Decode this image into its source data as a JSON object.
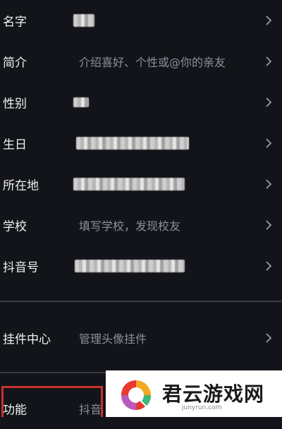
{
  "profile_rows": [
    {
      "label": "名字",
      "value": ""
    },
    {
      "label": "简介",
      "value": "介绍喜好、个性或@你的亲友"
    },
    {
      "label": "性别",
      "value": ""
    },
    {
      "label": "生日",
      "value": ""
    },
    {
      "label": "所在地",
      "value": ""
    },
    {
      "label": "学校",
      "value": "填写学校，发现校友"
    },
    {
      "label": "抖音号",
      "value": ""
    }
  ],
  "widget_row": {
    "label": "挂件中心",
    "value": "管理头像挂件"
  },
  "bottom_row": {
    "label": "功能",
    "value": "抖音"
  },
  "watermark": {
    "text": "君云游戏网",
    "subtext": "junyrun.com"
  },
  "colors": {
    "background": "#121419",
    "label": "#eef0f2",
    "value": "#8e9099",
    "highlight": "#c7312e"
  }
}
